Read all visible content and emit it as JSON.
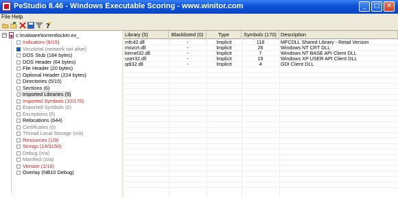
{
  "window": {
    "title": "PeStudio 8.46 - Windows Executable Scoring - www.winitor.com",
    "minimize_glyph": "_",
    "maximize_glyph": "□",
    "close_glyph": "✕"
  },
  "menu": [
    "File",
    "Help"
  ],
  "toolbar": [
    "open-folder-icon",
    "save-icon",
    "delete-icon",
    "floppy-icon",
    "filter-icon",
    "help-icon"
  ],
  "tree": {
    "root": "c:\\malware\\torrentlocker.ex_",
    "items": [
      {
        "label": "Indicators (6/15)",
        "tone": "red",
        "icon": "indicator-icon"
      },
      {
        "label": "Virustotal (network not alive)",
        "tone": "gray",
        "icon": "virustotal-icon"
      },
      {
        "label": "DOS Stub (184 bytes)",
        "tone": "black",
        "icon": "item-icon"
      },
      {
        "label": "DOS Header (64 bytes)",
        "tone": "black",
        "icon": "item-icon"
      },
      {
        "label": "File Header (20 bytes)",
        "tone": "black",
        "icon": "item-icon"
      },
      {
        "label": "Optional Header (224 bytes)",
        "tone": "black",
        "icon": "item-icon"
      },
      {
        "label": "Directories (5/15)",
        "tone": "black",
        "icon": "item-icon"
      },
      {
        "label": "Sections (6)",
        "tone": "black",
        "icon": "item-icon"
      },
      {
        "label": "Imported Libraries (5)",
        "tone": "black",
        "icon": "library-icon",
        "selected": true
      },
      {
        "label": "Imported Symbols (10/170)",
        "tone": "red",
        "icon": "item-icon"
      },
      {
        "label": "Exported Symbols (0)",
        "tone": "gray",
        "icon": "item-icon"
      },
      {
        "label": "Exceptions (0)",
        "tone": "gray",
        "icon": "item-icon"
      },
      {
        "label": "Relocations (644)",
        "tone": "black",
        "icon": "item-icon"
      },
      {
        "label": "Certificates (0)",
        "tone": "gray",
        "icon": "item-icon"
      },
      {
        "label": "Thread Local Storage (n/a)",
        "tone": "gray",
        "icon": "item-icon"
      },
      {
        "label": "Resources (1/9)",
        "tone": "red",
        "icon": "item-icon"
      },
      {
        "label": "Strings (19/3150)",
        "tone": "red",
        "icon": "item-icon"
      },
      {
        "label": "Debug (n/a)",
        "tone": "gray",
        "icon": "item-icon"
      },
      {
        "label": "Manifest (n/a)",
        "tone": "gray",
        "icon": "item-icon"
      },
      {
        "label": "Version (1/16)",
        "tone": "red",
        "icon": "item-icon"
      },
      {
        "label": "Overlay (NB10 Debug)",
        "tone": "black",
        "icon": "item-icon"
      }
    ]
  },
  "table": {
    "headers": [
      "Library (5)",
      "Blacklisted (0)",
      "Type",
      "Symbols (170)",
      "Description"
    ],
    "rows": [
      [
        "mfc42.dll",
        "-",
        "Implicit",
        "118",
        "MFCDLL Shared Library - Retail Version"
      ],
      [
        "msvcrt.dll",
        "-",
        "Implicit",
        "26",
        "Windows NT CRT DLL"
      ],
      [
        "kernel32.dll",
        "-",
        "Implicit",
        "7",
        "Windows NT BASE API Client DLL"
      ],
      [
        "user32.dll",
        "-",
        "Implicit",
        "15",
        "Windows XP USER API Client DLL"
      ],
      [
        "gdi32.dll",
        "-",
        "Implicit",
        "4",
        "GDI Client DLL"
      ]
    ]
  },
  "colors": {
    "titlebar": "#0a52d6",
    "highlight_red": "#d21f1f",
    "muted_gray": "#7a7a7a",
    "chrome": "#ece9d8"
  }
}
